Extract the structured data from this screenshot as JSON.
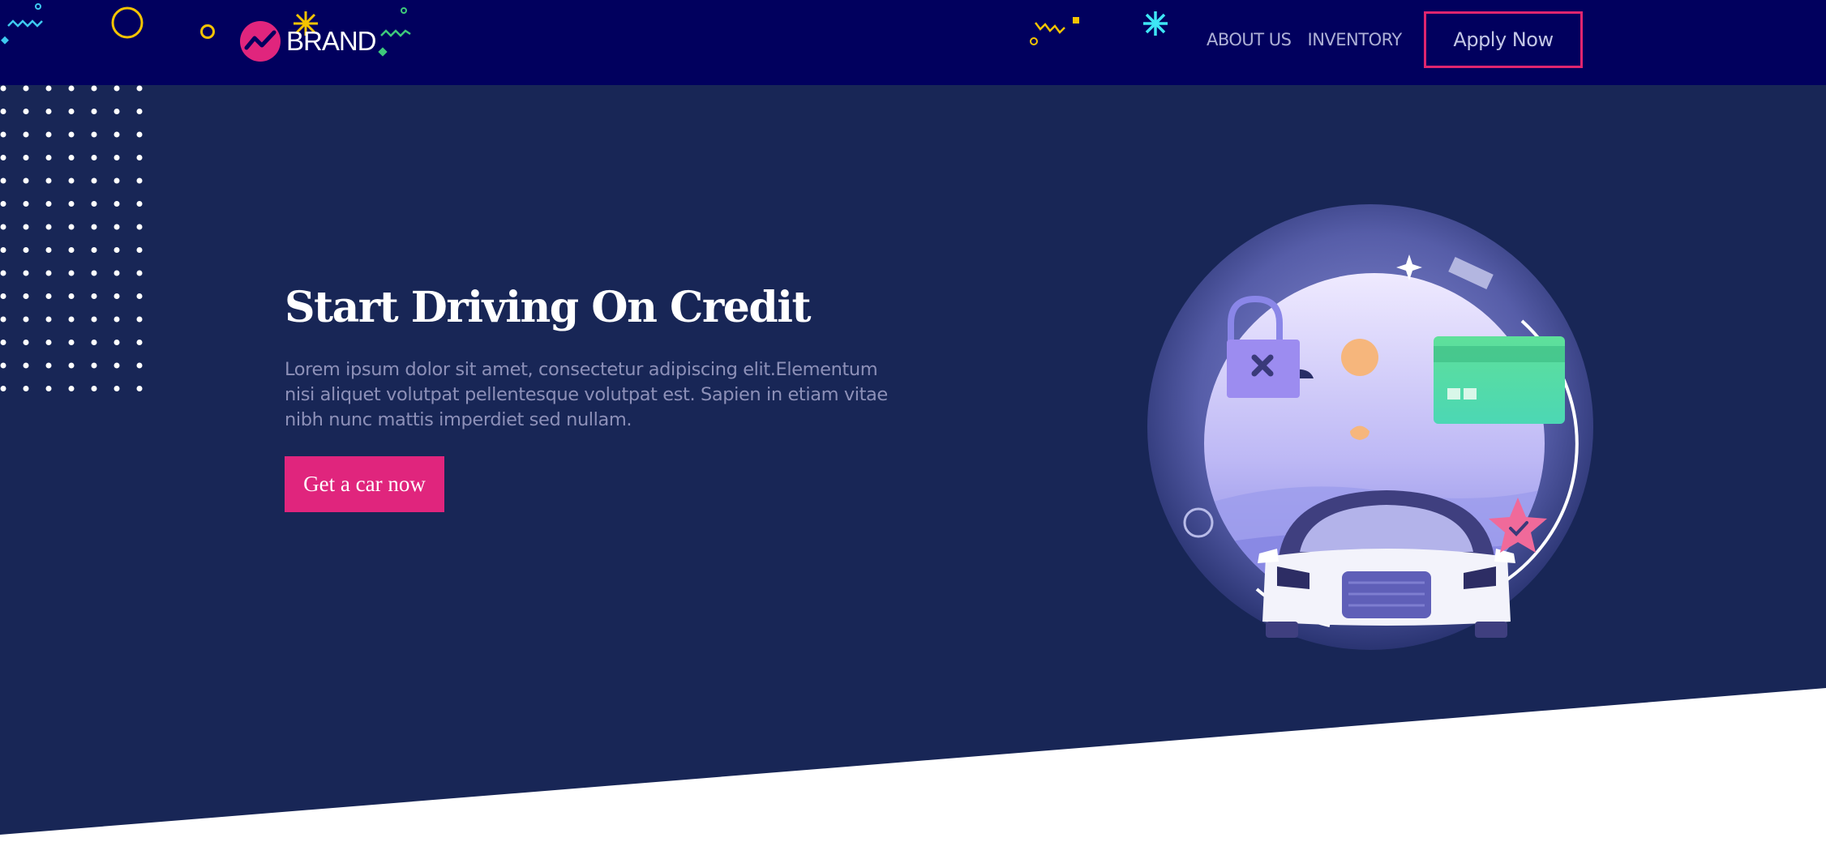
{
  "header": {
    "brand": "BRAND",
    "nav": [
      {
        "label": "ABOUT US"
      },
      {
        "label": "INVENTORY"
      }
    ],
    "apply_label": "Apply Now"
  },
  "hero": {
    "title": "Start Driving On Credit",
    "text": "Lorem ipsum dolor sit amet, consectetur adipiscing elit.Elementum nisi aliquet volutpat pellentesque volutpat est. Sapien in etiam vitae nibh nunc mattis imperdiet sed nullam.",
    "cta_label": "Get a car now"
  },
  "colors": {
    "navbar_bg": "#01005e",
    "hero_bg": "#182656",
    "accent": "#e0257d",
    "page_bg": "#ffffff"
  }
}
